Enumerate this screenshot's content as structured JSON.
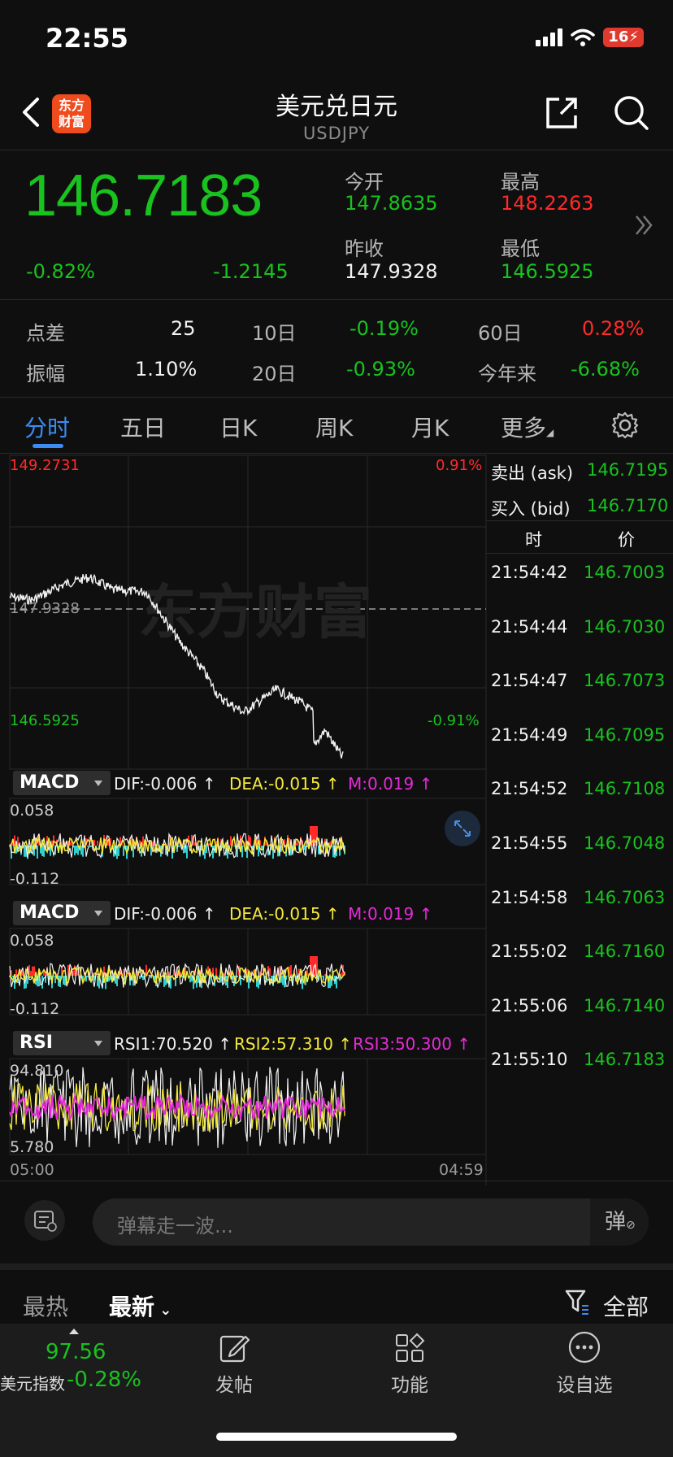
{
  "status": {
    "time": "22:55",
    "battery": "16"
  },
  "header": {
    "title": "美元兑日元",
    "subtitle": "USDJPY",
    "logo": "东方\n财富"
  },
  "quote": {
    "price": "146.7183",
    "change_pct": "-0.82%",
    "change": "-1.2145",
    "open_label": "今开",
    "open": "147.8635",
    "high_label": "最高",
    "high": "148.2263",
    "prev_close_label": "昨收",
    "prev_close": "147.9328",
    "low_label": "最低",
    "low": "146.5925"
  },
  "stats": {
    "spread_label": "点差",
    "spread": "25",
    "d10_label": "10日",
    "d10": "-0.19%",
    "d60_label": "60日",
    "d60": "0.28%",
    "amp_label": "振幅",
    "amp": "1.10%",
    "d20_label": "20日",
    "d20": "-0.93%",
    "ytd_label": "今年来",
    "ytd": "-6.68%"
  },
  "tabs": [
    "分时",
    "五日",
    "日K",
    "周K",
    "月K",
    "更多"
  ],
  "chart": {
    "top_price": "149.2731",
    "top_pct": "0.91%",
    "mid_price": "147.9328",
    "bottom_price": "146.5925",
    "bottom_pct": "-0.91%",
    "watermark": "东方财富",
    "time_start": "05:00",
    "time_end": "04:59"
  },
  "macd1": {
    "name": "MACD",
    "dif": "DIF:-0.006 ↑",
    "dea": "DEA:-0.015 ↑",
    "m": "M:0.019 ↑",
    "max": "0.058",
    "min": "-0.112"
  },
  "macd2": {
    "name": "MACD",
    "dif": "DIF:-0.006 ↑",
    "dea": "DEA:-0.015 ↑",
    "m": "M:0.019 ↑",
    "max": "0.058",
    "min": "-0.112"
  },
  "rsi": {
    "name": "RSI",
    "rsi1": "RSI1:70.520 ↑",
    "rsi2": "RSI2:57.310 ↑",
    "rsi3": "RSI3:50.300 ↑",
    "max": "94.810",
    "min": "5.780"
  },
  "orderbook": {
    "ask_label": "卖出 (ask)",
    "ask": "146.7195",
    "bid_label": "买入 (bid)",
    "bid": "146.7170",
    "time_header": "时",
    "price_header": "价",
    "ticks": [
      {
        "time": "21:54:42",
        "price": "146.7003"
      },
      {
        "time": "21:54:44",
        "price": "146.7030"
      },
      {
        "time": "21:54:47",
        "price": "146.7073"
      },
      {
        "time": "21:54:49",
        "price": "146.7095"
      },
      {
        "time": "21:54:52",
        "price": "146.7108"
      },
      {
        "time": "21:54:55",
        "price": "146.7048"
      },
      {
        "time": "21:54:58",
        "price": "146.7063"
      },
      {
        "time": "21:55:02",
        "price": "146.7160"
      },
      {
        "time": "21:55:06",
        "price": "146.7140"
      },
      {
        "time": "21:55:10",
        "price": "146.7183"
      }
    ]
  },
  "comment": {
    "placeholder": "弹幕走一波...",
    "danmu": "弹"
  },
  "feed": {
    "hot": "最热",
    "new": "最新",
    "filter": "全部"
  },
  "bottom": {
    "index_value": "97.56",
    "index_name": "美元指数",
    "index_pct": "-0.28%",
    "post": "发帖",
    "func": "功能",
    "watch": "设自选"
  },
  "colors": {
    "up": "#ff2a2a",
    "down": "#19c21f",
    "accent": "#3b8cf3"
  }
}
